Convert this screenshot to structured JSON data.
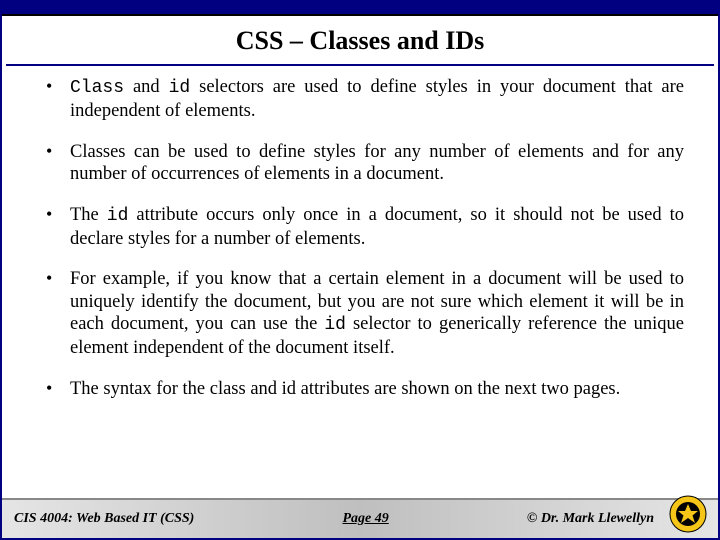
{
  "title": "CSS – Classes and IDs",
  "bullets": [
    {
      "pre": "",
      "mono1": "Class",
      "mid1": " and ",
      "mono2": "id",
      "post": " selectors are used to define styles in your document that are independent of elements."
    },
    {
      "plain": "Classes can be used to define styles for any number of elements and for any number of occurrences of elements in a document."
    },
    {
      "pre": "The ",
      "mono1": "id",
      "post": " attribute occurs only once in a document, so it should not be used to declare styles for a number of elements."
    },
    {
      "pre": "For example, if you know that a certain element in a document will be used to uniquely identify the document, but you are not sure which element it will be in each document, you can use the ",
      "mono1": "id",
      "post": " selector to generically reference the unique element independent of the document itself."
    },
    {
      "plain": "The syntax for the class and id attributes are shown on the next two pages."
    }
  ],
  "footer": {
    "left": "CIS 4004: Web Based IT (CSS)",
    "center": "Page 49",
    "right": "© Dr. Mark Llewellyn"
  }
}
